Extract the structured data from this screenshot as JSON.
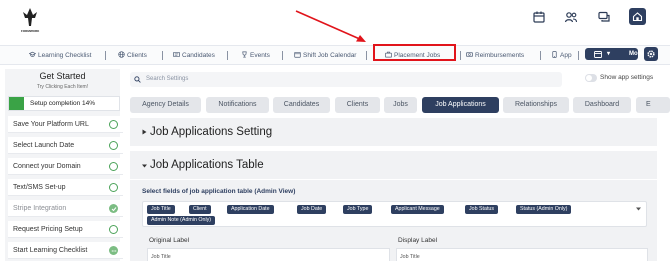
{
  "header": {
    "logo_name": "logo",
    "logo_text": "FORMWORK",
    "icons": [
      "calendar-icon",
      "users-icon",
      "chat-icon",
      "home-icon"
    ]
  },
  "nav": {
    "items": [
      {
        "label": "Learning Checklist",
        "icon": "graduation-cap-icon"
      },
      {
        "label": "Clients",
        "icon": "globe-icon"
      },
      {
        "label": "Candidates",
        "icon": "id-card-icon"
      },
      {
        "label": "Events",
        "icon": "trophy-icon"
      },
      {
        "label": "Shift Job Calendar",
        "icon": "calendar-icon"
      },
      {
        "label": "Placement Jobs",
        "icon": "briefcase-icon"
      },
      {
        "label": "Reimbursements",
        "icon": "money-icon"
      },
      {
        "label": "App",
        "icon": "phone-icon"
      }
    ],
    "more_label": "More",
    "highlight_color": "#e1141b"
  },
  "sidebar": {
    "title": "Get Started",
    "subtitle": "Try Clicking Each Item!",
    "progress_label": "Setup completion 14%",
    "progress_value": 0.14,
    "items": [
      {
        "label": "Save Your Platform URL",
        "state": "todo"
      },
      {
        "label": "Select Launch Date",
        "state": "todo"
      },
      {
        "label": "Connect your Domain",
        "state": "todo"
      },
      {
        "label": "Text/SMS Set-up",
        "state": "todo"
      },
      {
        "label": "Stripe Integration",
        "state": "done"
      },
      {
        "label": "Request Pricing Setup",
        "state": "todo"
      },
      {
        "label": "Start Learning Checklist",
        "state": "more"
      }
    ]
  },
  "search": {
    "placeholder": "Search Settings",
    "toggle_label": "Show app settings"
  },
  "tabs": [
    {
      "label": "Agency Details",
      "active": false
    },
    {
      "label": "Notifications",
      "active": false
    },
    {
      "label": "Candidates",
      "active": false
    },
    {
      "label": "Clients",
      "active": false
    },
    {
      "label": "Jobs",
      "active": false
    },
    {
      "label": "Job Applications",
      "active": true
    },
    {
      "label": "Relationships",
      "active": false
    },
    {
      "label": "Dashboard",
      "active": false
    },
    {
      "label": "E",
      "active": false
    }
  ],
  "sections": {
    "settings_title": "Job Applications Setting",
    "table_title": "Job Applications Table",
    "select_label": "Select fields of job application table (Admin View)",
    "chips": [
      "Job Title",
      "Client",
      "Application Date",
      "Job Date",
      "Job Type",
      "Applicant Message",
      "Job Status",
      "Status (Admin Only)",
      "Admin Note (Admin Only)"
    ],
    "original_label_head": "Original Label",
    "display_label_head": "Display Label",
    "original_value": "Job Title",
    "display_value": "Job Title"
  },
  "colors": {
    "brand": "#2e3f60",
    "success": "#3aa346",
    "annotation": "#e1141b"
  }
}
